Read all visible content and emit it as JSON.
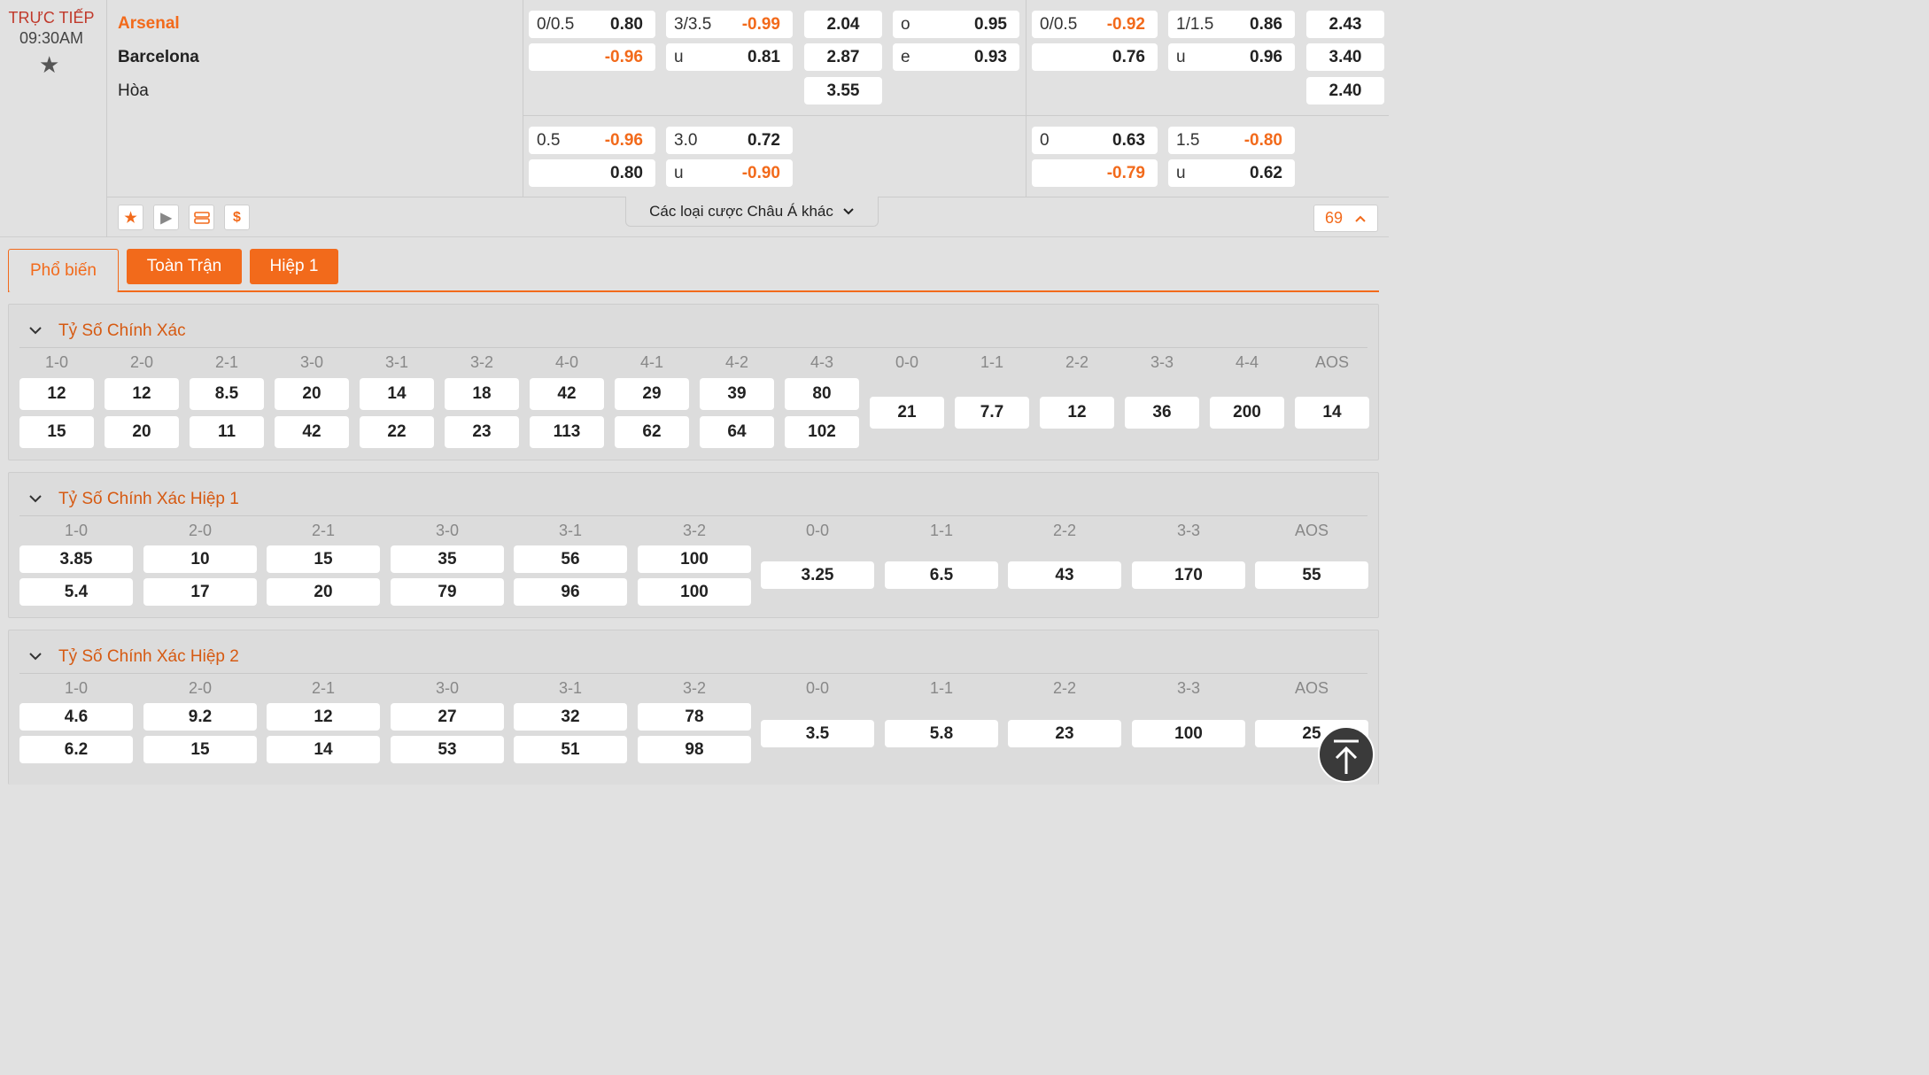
{
  "match": {
    "status": "TRỰC TIẾP",
    "time": "09:30AM",
    "home": "Arsenal",
    "away": "Barcelona",
    "draw": "Hòa",
    "more_label": "Các loại cược Châu Á khác",
    "count": "69"
  },
  "odds": {
    "ft_hdp_1": {
      "line": "0/0.5",
      "home": "0.80",
      "away": "-0.96"
    },
    "ft_ou_1": {
      "line": "3/3.5",
      "over": "-0.99",
      "u_label": "u",
      "under": "0.81"
    },
    "ft_1x2": {
      "h": "2.04",
      "a": "2.87",
      "d": "3.55"
    },
    "ft_oe": {
      "o_label": "o",
      "o": "0.95",
      "e_label": "e",
      "e": "0.93"
    },
    "ht_hdp_1": {
      "line": "0/0.5",
      "home": "-0.92",
      "away": "0.76"
    },
    "ht_ou_1": {
      "line": "1/1.5",
      "over": "0.86",
      "u_label": "u",
      "under": "0.96"
    },
    "ht_1x2": {
      "h": "2.43",
      "a": "3.40",
      "d": "2.40"
    },
    "ft_hdp_2": {
      "line": "0.5",
      "home": "-0.96",
      "away": "0.80"
    },
    "ft_ou_2": {
      "line": "3.0",
      "over": "0.72",
      "u_label": "u",
      "under": "-0.90"
    },
    "ht_hdp_2": {
      "line": "0",
      "home": "0.63",
      "away": "-0.79"
    },
    "ht_ou_2": {
      "line": "1.5",
      "over": "-0.80",
      "u_label": "u",
      "under": "0.62"
    }
  },
  "tabs": [
    "Phổ biến",
    "Toàn Trận",
    "Hiệp 1"
  ],
  "sections": [
    {
      "title": "Tỷ Số Chính Xác",
      "pair_headers": [
        "1-0",
        "2-0",
        "2-1",
        "3-0",
        "3-1",
        "3-2",
        "4-0",
        "4-1",
        "4-2",
        "4-3"
      ],
      "pair_top": [
        "12",
        "12",
        "8.5",
        "20",
        "14",
        "18",
        "42",
        "29",
        "39",
        "80"
      ],
      "pair_bottom": [
        "15",
        "20",
        "11",
        "42",
        "22",
        "23",
        "113",
        "62",
        "64",
        "102"
      ],
      "single_headers": [
        "0-0",
        "1-1",
        "2-2",
        "3-3",
        "4-4",
        "AOS"
      ],
      "single_values": [
        "21",
        "7.7",
        "12",
        "36",
        "200",
        "14"
      ]
    },
    {
      "title": "Tỷ Số Chính Xác Hiệp 1",
      "pair_headers": [
        "1-0",
        "2-0",
        "2-1",
        "3-0",
        "3-1",
        "3-2"
      ],
      "pair_top": [
        "3.85",
        "10",
        "15",
        "35",
        "56",
        "100"
      ],
      "pair_bottom": [
        "5.4",
        "17",
        "20",
        "79",
        "96",
        "100"
      ],
      "single_headers": [
        "0-0",
        "1-1",
        "2-2",
        "3-3",
        "AOS"
      ],
      "single_values": [
        "3.25",
        "6.5",
        "43",
        "170",
        "55"
      ]
    },
    {
      "title": "Tỷ Số Chính Xác Hiệp 2",
      "pair_headers": [
        "1-0",
        "2-0",
        "2-1",
        "3-0",
        "3-1",
        "3-2"
      ],
      "pair_top": [
        "4.6",
        "9.2",
        "12",
        "27",
        "32",
        "78"
      ],
      "pair_bottom": [
        "6.2",
        "15",
        "14",
        "53",
        "51",
        "98"
      ],
      "single_headers": [
        "0-0",
        "1-1",
        "2-2",
        "3-3",
        "AOS"
      ],
      "single_values": [
        "3.5",
        "5.8",
        "23",
        "100",
        "25"
      ]
    }
  ],
  "colors": {
    "accent": "#f26a1b",
    "live": "#c0392b",
    "title": "#d65a12"
  }
}
